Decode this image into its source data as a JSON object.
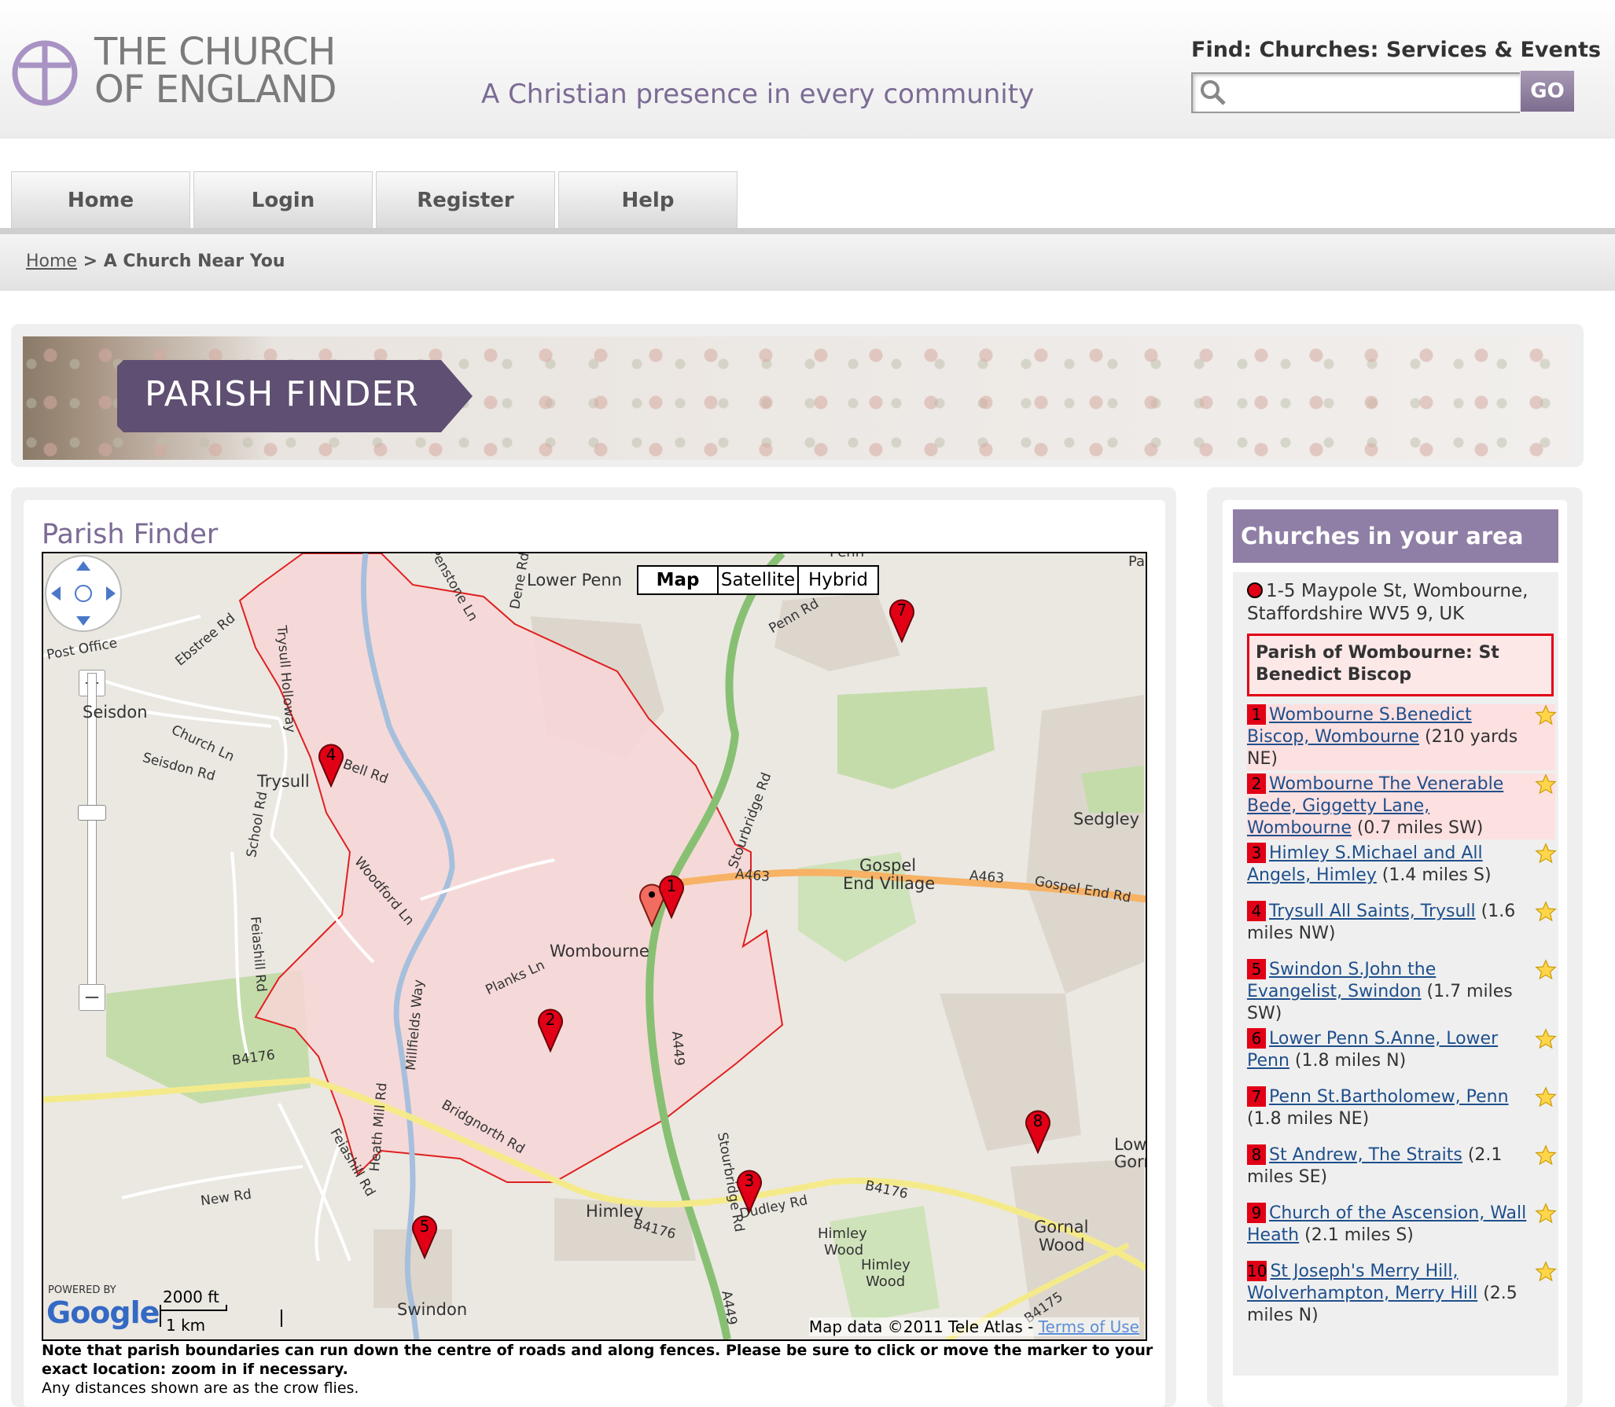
{
  "header": {
    "logo_line1": "THE CHURCH",
    "logo_line2": "OF ENGLAND",
    "tagline": "A Christian presence in every community",
    "find_label": "Find: Churches: Services & Events",
    "search_placeholder": "",
    "go_label": "GO"
  },
  "nav": {
    "tabs": [
      {
        "label": "Home"
      },
      {
        "label": "Login"
      },
      {
        "label": "Register"
      },
      {
        "label": "Help"
      }
    ]
  },
  "breadcrumb": {
    "home": "Home",
    "separator": " > ",
    "current": "A Church Near You"
  },
  "banner": {
    "title": "PARISH FINDER"
  },
  "main": {
    "title": "Parish Finder",
    "map": {
      "types": [
        "Map",
        "Satellite",
        "Hybrid"
      ],
      "active_type": "Map",
      "places": {
        "lower_penn": "Lower Penn",
        "seisdon": "Seisdon",
        "trysull": "Trysull",
        "wombourne": "Wombourne",
        "gospel_end": "Gospel",
        "gospel_end2": "End Village",
        "sedgley": "Sedgley",
        "himley": "Himley",
        "swindon": "Swindon",
        "himley_wood1": "Himley",
        "himley_wood2": "Wood",
        "himley_wood3": "Himley",
        "himley_wood4": "Wood",
        "gornal1": "Gornal",
        "gornal2": "Wood",
        "lower_gornal1": "Lowe",
        "lower_gornal2": "Gorn",
        "park": "Park",
        "penn": "Penn"
      },
      "roads": {
        "penn_rd": "Penn Rd",
        "ebstree_rd": "Ebstree Rd",
        "church_ln": "Church Ln",
        "seisdon_rd": "Seisdon Rd",
        "bell_rd": "Bell Rd",
        "school_rd": "School Rd",
        "woodford_ln": "Woodford Ln",
        "feiashill_rd": "Feiashill Rd",
        "planks_ln": "Planks Ln",
        "b4176_left": "B4176",
        "bridgnorth_rd": "Bridgnorth Rd",
        "heath_mill_rd": "Heath Mill Rd",
        "new_rd": "New Rd",
        "feiashill_rd2": "Feiashill Rd",
        "stourbridge_rd": "Stourbridge Rd",
        "stourbridge_rd2": "Stourbridge Rd",
        "a463_1": "A463",
        "a463_2": "A463",
        "gospel_end_rd": "Gospel End Rd",
        "a449_1": "A449",
        "a449_2": "A449",
        "dudley_rd": "Dudley Rd",
        "b4176_mid": "B4176",
        "b4176_right": "B4176",
        "b4175": "B4175",
        "trysull_holloway": "Trysull Holloway",
        "penstone_ln": "Penstone Ln",
        "dene_rd": "Dene Rd",
        "post_office_rd": "Post Office",
        "mill_fields_way": "Millfields Way"
      },
      "markers": [
        "1",
        "2",
        "3",
        "4",
        "5",
        "7",
        "8"
      ],
      "powered_by": "POWERED BY",
      "google": "Google",
      "scale_ft": "2000 ft",
      "scale_km": "1 km",
      "attribution": "Map data ©2011 Tele Atlas - ",
      "terms": "Terms of Use"
    },
    "note_bold": "Note that parish boundaries can run down the centre of roads and along fences. Please be sure to click or move the marker to your exact location: zoom in if necessary.",
    "note_plain": "Any distances shown are as the crow flies."
  },
  "sidebar": {
    "title": "Churches in your area",
    "address": "1-5 Maypole St, Wombourne, Staffordshire WV5 9, UK",
    "parish": "Parish of Wombourne: St Benedict Biscop",
    "churches": [
      {
        "num": "1",
        "name": "Wombourne S.Benedict Biscop, Wombourne",
        "dist": " (210 yards NE)"
      },
      {
        "num": "2",
        "name": "Wombourne The Venerable Bede, Giggetty Lane, Wombourne",
        "dist": " (0.7 miles SW)"
      },
      {
        "num": "3",
        "name": "Himley S.Michael and All Angels, Himley",
        "dist": " (1.4 miles S)"
      },
      {
        "num": "4",
        "name": "Trysull All Saints, Trysull",
        "dist": " (1.6 miles NW)"
      },
      {
        "num": "5",
        "name": "Swindon S.John the Evangelist, Swindon",
        "dist": " (1.7 miles SW)"
      },
      {
        "num": "6",
        "name": "Lower Penn S.Anne, Lower Penn",
        "dist": " (1.8 miles N)"
      },
      {
        "num": "7",
        "name": "Penn St.Bartholomew, Penn",
        "dist": " (1.8 miles NE)"
      },
      {
        "num": "8",
        "name": "St Andrew, The Straits",
        "dist": " (2.1 miles SE)"
      },
      {
        "num": "9",
        "name": "Church of the Ascension, Wall Heath",
        "dist": " (2.1 miles S)"
      },
      {
        "num": "10",
        "name": "St Joseph's Merry Hill, Wolverhampton, Merry Hill",
        "dist": " (2.5 miles N)"
      }
    ]
  },
  "colors": {
    "brand_purple": "#7c6b95",
    "panel_purple": "#8f7fa6",
    "marker_red": "#e20016",
    "parish_fill": "#f7d6d6",
    "link_blue": "#1e4f8c"
  }
}
